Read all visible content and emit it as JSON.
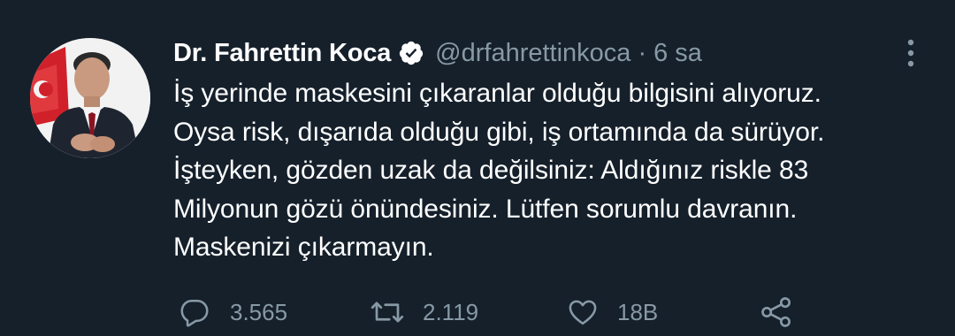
{
  "tweet": {
    "author_name": "Dr. Fahrettin Koca",
    "verified_icon": "verified-badge-icon",
    "handle": "@drfahrettinkoca",
    "separator": "·",
    "time": "6 sa",
    "more_icon": "more-vertical-icon",
    "text_lines": [
      "İş yerinde maskesini çıkaranlar olduğu bilgisini alıyoruz.",
      "Oysa risk, dışarıda olduğu gibi, iş ortamında da sürüyor.",
      "İşteyken, gözden uzak da değilsiniz: Aldığınız riskle 83",
      "Milyonun gözü önündesiniz. Lütfen sorumlu davranın.",
      "Maskenizi çıkarmayın."
    ]
  },
  "actions": {
    "reply": {
      "icon": "reply-icon",
      "count": "3.565"
    },
    "retweet": {
      "icon": "retweet-icon",
      "count": "2.119"
    },
    "like": {
      "icon": "heart-icon",
      "count": "18B"
    },
    "share": {
      "icon": "share-icon"
    }
  },
  "colors": {
    "background": "#15202b",
    "text_primary": "#ffffff",
    "text_secondary": "#8899a6"
  }
}
